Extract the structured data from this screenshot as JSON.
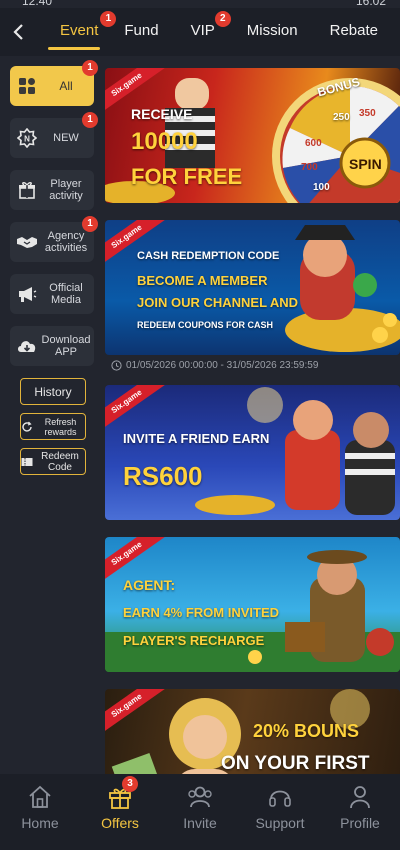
{
  "status": {
    "time": "12:40",
    "right": "16:02"
  },
  "topnav": {
    "tabs": [
      {
        "label": "Event",
        "badge": "1"
      },
      {
        "label": "Fund",
        "badge": ""
      },
      {
        "label": "VIP",
        "badge": "2"
      },
      {
        "label": "Mission",
        "badge": ""
      },
      {
        "label": "Rebate",
        "badge": ""
      }
    ]
  },
  "sidebar": {
    "items": [
      {
        "label": "All",
        "badge": "1",
        "icon": "grid-icon"
      },
      {
        "label": "NEW",
        "badge": "1",
        "icon": "new-badge-icon"
      },
      {
        "label": "Player activity",
        "badge": "",
        "icon": "gift-icon"
      },
      {
        "label": "Agency activities",
        "badge": "1",
        "icon": "handshake-icon"
      },
      {
        "label": "Official Media",
        "badge": "",
        "icon": "megaphone-icon"
      },
      {
        "label": "Download APP",
        "badge": "",
        "icon": "cloud-download-icon"
      }
    ],
    "history": "History",
    "refresh": "Refresh rewards",
    "redeem": "Redeem Code"
  },
  "banners": [
    {
      "brand": "Six.game",
      "line1": "RECEIVE",
      "line2": "10000",
      "line3": "FOR FREE",
      "wheel_top": "BONUS",
      "wheel_center": "SPIN",
      "wheel_values": [
        "350",
        "600",
        "700",
        "100",
        "250"
      ]
    },
    {
      "brand": "Six.game",
      "title": "CASH REDEMPTION CODE",
      "line1": "BECOME A MEMBER",
      "line2": "JOIN OUR CHANNEL AND",
      "line3": "REDEEM COUPONS FOR CASH",
      "date": "01/05/2026 00:00:00 - 31/05/2026 23:59:59"
    },
    {
      "brand": "Six.game",
      "line1": "INVITE A FRIEND EARN",
      "line2": "RS600"
    },
    {
      "brand": "Six.game",
      "line1": "AGENT:",
      "line2": "EARN 4% FROM INVITED",
      "line3": "PLAYER'S RECHARGE"
    },
    {
      "brand": "Six.game",
      "line1": "20% BOUNS",
      "line2": "ON YOUR FIRST"
    }
  ],
  "bottomnav": {
    "items": [
      {
        "label": "Home",
        "badge": "",
        "icon": "home-icon"
      },
      {
        "label": "Offers",
        "badge": "3",
        "icon": "gift-box-icon"
      },
      {
        "label": "Invite",
        "badge": "",
        "icon": "users-icon"
      },
      {
        "label": "Support",
        "badge": "",
        "icon": "headset-icon"
      },
      {
        "label": "Profile",
        "badge": "",
        "icon": "person-icon"
      }
    ]
  },
  "colors": {
    "accent": "#f4c542",
    "badge": "#e23b2e",
    "background": "#22252e",
    "bar": "#1c1f27"
  }
}
